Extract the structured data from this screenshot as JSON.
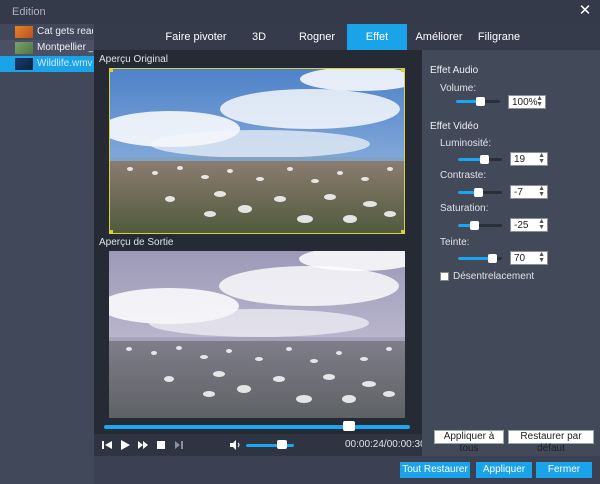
{
  "window": {
    "title": "Edition"
  },
  "files": [
    {
      "name": "Cat gets ready..."
    },
    {
      "name": "Montpellier _ ..."
    },
    {
      "name": "Wildlife.wmv"
    }
  ],
  "tabs": [
    {
      "label": "Faire pivoter"
    },
    {
      "label": "3D"
    },
    {
      "label": "Rogner"
    },
    {
      "label": "Effet"
    },
    {
      "label": "Améliorer"
    },
    {
      "label": "Filigrane"
    }
  ],
  "preview": {
    "original_label": "Aperçu Original",
    "output_label": "Aperçu de Sortie",
    "timecode": "00:00:24/00:00:30",
    "seek_position": 0.8,
    "volume_level": 0.75
  },
  "effects": {
    "audio_title": "Effet Audio",
    "volume": {
      "label": "Volume:",
      "value": "100%"
    },
    "video_title": "Effet Vidéo",
    "brightness": {
      "label": "Luminosité:",
      "value": "19"
    },
    "contrast": {
      "label": "Contraste:",
      "value": "-7"
    },
    "saturation": {
      "label": "Saturation:",
      "value": "-25"
    },
    "hue": {
      "label": "Teinte:",
      "value": "70"
    },
    "deinterlace_label": "Désentrelacement",
    "apply_all": "Appliquer à tous",
    "restore_default": "Restaurer par défaut"
  },
  "footer": {
    "restore_all": "Tout Restaurer",
    "apply": "Appliquer",
    "close": "Fermer"
  },
  "colors": {
    "accent": "#1aa3e8",
    "crop_border": "#d9d13a"
  }
}
